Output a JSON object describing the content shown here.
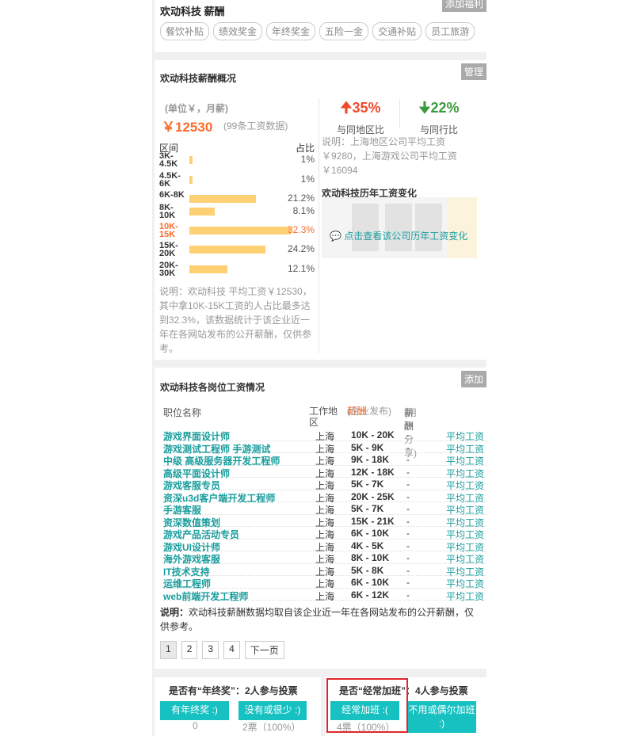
{
  "benefits": {
    "company_name": "欢动科技 薪酬",
    "tags": [
      "餐饮补贴",
      "绩效奖金",
      "年终奖金",
      "五险一金",
      "交通补贴",
      "员工旅游"
    ],
    "corner_label": "添加福利"
  },
  "overview": {
    "title": "欢动科技薪酬概况",
    "manage_label": "管理",
    "unit": "(单位￥，月薪)",
    "avg_salary": "￥12530",
    "data_count": "(99条工资数据)",
    "dist_header_range": "区间",
    "dist_header_pct": "占比",
    "distribution": [
      {
        "range": "3K-4.5K",
        "pct": "1%",
        "value": 1
      },
      {
        "range": "4.5K-6K",
        "pct": "1%",
        "value": 1
      },
      {
        "range": "6K-8K",
        "pct": "21.2%",
        "value": 21.2
      },
      {
        "range": "8K-10K",
        "pct": "8.1%",
        "value": 8.1
      },
      {
        "range": "10K-15K",
        "pct": "32.3%",
        "value": 32.3,
        "highlight": true
      },
      {
        "range": "15K-20K",
        "pct": "24.2%",
        "value": 24.2
      },
      {
        "range": "20K-30K",
        "pct": "12.1%",
        "value": 12.1
      }
    ],
    "dist_note": "说明：欢动科技 平均工资￥12530，其中拿10K-15K工资的人占比最多达到32.3%，该数据统计于该企业近一年在各网站发布的公开薪酬，仅供参考。",
    "compare_region_value": "35%",
    "compare_region_label": "与同地区比",
    "compare_industry_value": "22%",
    "compare_industry_label": "与同行比",
    "compare_note": "说明：上海地区公司平均工资￥9280，上海游戏公司平均工资￥16094",
    "history_title": "欢动科技历年工资变化",
    "history_link": "点击查看该公司历年工资变化"
  },
  "positions": {
    "title": "欢动科技各岗位工资情况",
    "add_label": "添加",
    "headers": {
      "title": "职位名称",
      "location": "工作地区",
      "enterprise": "薪酬",
      "enterprise_arrow": "↓",
      "enterprise_note": "(企业发布)",
      "user": "薪酬",
      "user_note": "(用户分享)"
    },
    "rows": [
      {
        "title": "游戏界面设计师",
        "location": "上海",
        "salary": "10K - 20K",
        "user": "-",
        "link": "平均工资"
      },
      {
        "title": "游戏测试工程师 手游测试",
        "location": "上海",
        "salary": "5K - 9K",
        "user": "-",
        "link": "平均工资"
      },
      {
        "title": "中级 高级服务器开发工程师",
        "location": "上海",
        "salary": "9K - 18K",
        "user": "-",
        "link": "平均工资"
      },
      {
        "title": "高级平面设计师",
        "location": "上海",
        "salary": "12K - 18K",
        "user": "-",
        "link": "平均工资"
      },
      {
        "title": "游戏客服专员",
        "location": "上海",
        "salary": "5K - 7K",
        "user": "-",
        "link": "平均工资"
      },
      {
        "title": "资深u3d客户端开发工程师",
        "location": "上海",
        "salary": "20K - 25K",
        "user": "-",
        "link": "平均工资"
      },
      {
        "title": "手游客服",
        "location": "上海",
        "salary": "5K - 7K",
        "user": "-",
        "link": "平均工资"
      },
      {
        "title": "资深数值策划",
        "location": "上海",
        "salary": "15K - 21K",
        "user": "-",
        "link": "平均工资"
      },
      {
        "title": "游戏产品活动专员",
        "location": "上海",
        "salary": "6K - 10K",
        "user": "-",
        "link": "平均工资"
      },
      {
        "title": "游戏UI设计师",
        "location": "上海",
        "salary": "4K - 5K",
        "user": "-",
        "link": "平均工资"
      },
      {
        "title": "海外游戏客服",
        "location": "上海",
        "salary": "8K - 10K",
        "user": "-",
        "link": "平均工资"
      },
      {
        "title": "IT技术支持",
        "location": "上海",
        "salary": "5K - 8K",
        "user": "-",
        "link": "平均工资"
      },
      {
        "title": "运维工程师",
        "location": "上海",
        "salary": "6K - 10K",
        "user": "-",
        "link": "平均工资"
      },
      {
        "title": "web前端开发工程师",
        "location": "上海",
        "salary": "6K - 12K",
        "user": "-",
        "link": "平均工资"
      }
    ],
    "note_label": "说明：",
    "note_text": "欢动科技薪酬数据均取自该企业近一年在各网站发布的公开薪酬，仅供参考。",
    "pages": [
      "1",
      "2",
      "3",
      "4"
    ],
    "next_label": "下一页"
  },
  "polls": {
    "bonus_question": "是否有“年终奖”：2人参与投票",
    "bonus_yes": "有年终奖 :)",
    "bonus_no": "没有或很少 :)",
    "bonus_yes_count": "0",
    "bonus_no_count": "2票（100%）",
    "overtime_question": "是否“经常加班”：4人参与投票",
    "overtime_yes": "经常加班 :(",
    "overtime_no": "不用或偶尔加班 :)",
    "overtime_yes_count": "4票（100%）"
  },
  "colors": {
    "accent_orange": "#ff6a2b",
    "teal": "#1a9d9d",
    "button_teal": "#17c1c1",
    "bar_yellow": "#fdd074",
    "up_red": "#f04b2e",
    "down_green": "#3a9b3a",
    "highlight_box": "#e0262b"
  }
}
